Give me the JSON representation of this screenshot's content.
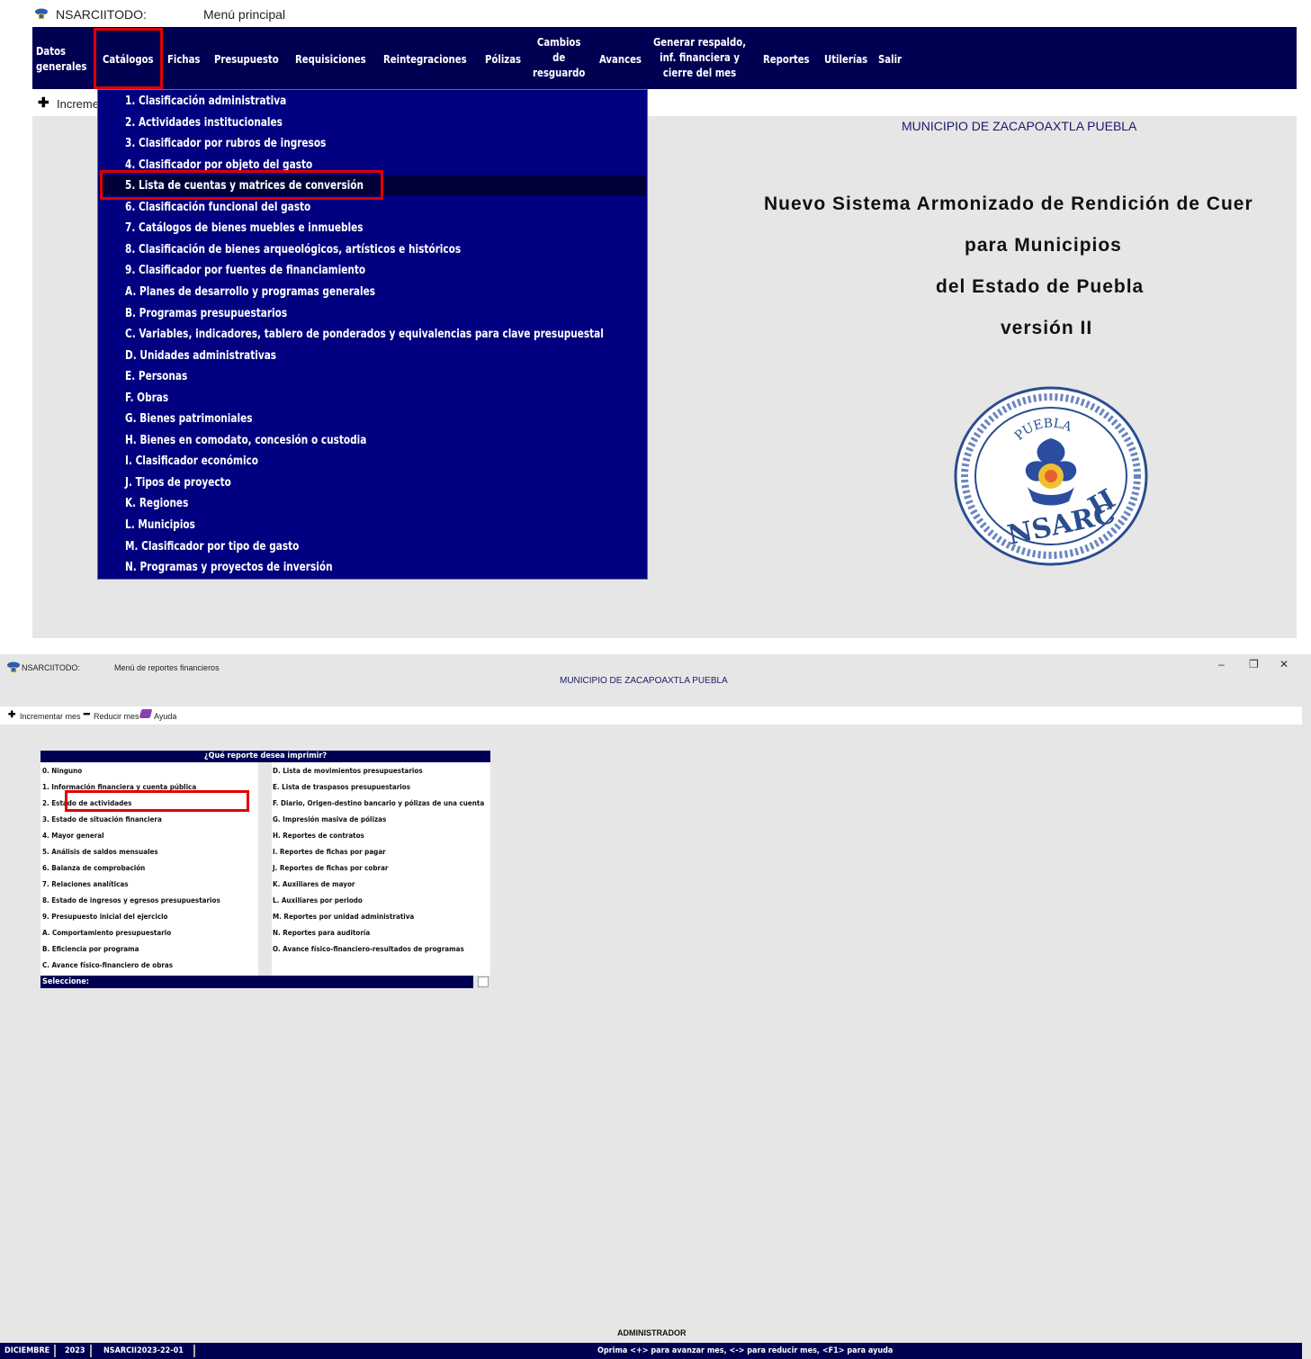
{
  "top": {
    "window": {
      "app_name": "NSARCIITODO:",
      "title": "Menú principal"
    },
    "menubar": [
      "Datos\ngenerales",
      "Catálogos",
      "Fichas",
      "Presupuesto",
      "Requisiciones",
      "Reintegraciones",
      "Pólizas",
      "Cambios\nde\nresguardo",
      "Avances",
      "Generar respaldo,\ninf. financiera y\ncierre del mes",
      "Reportes",
      "Utilerías",
      "Salir"
    ],
    "toolbar_partial": "Increme",
    "catalog_menu": [
      "1. Clasificación administrativa",
      "2. Actividades institucionales",
      "3. Clasificador por rubros de ingresos",
      "4. Clasificador por objeto del gasto",
      "5. Lista de cuentas y matrices de conversión",
      "6. Clasificación funcional del gasto",
      "7. Catálogos de bienes muebles e inmuebles",
      "8. Clasificación de bienes arqueológicos, artísticos e históricos",
      "9. Clasificador por fuentes de financiamiento",
      "A. Planes de desarrollo y programas generales",
      "B. Programas presupuestarios",
      "C. Variables, indicadores, tablero de ponderados y equivalencias para clave presupuestal",
      "D. Unidades administrativas",
      "E. Personas",
      "F. Obras",
      "G. Bienes patrimoniales",
      "H. Bienes en comodato, concesión o custodia",
      "I. Clasificador económico",
      "J. Tipos de proyecto",
      "K. Regiones",
      "L. Municipios",
      "M. Clasificador por tipo de gasto",
      "N. Programas y proyectos de inversión"
    ],
    "highlighted_index": 4,
    "municipality": "MUNICIPIO DE ZACAPOAXTLA PUEBLA",
    "hero_lines": [
      "Nuevo Sistema Armonizado de Rendición de Cuer",
      "para Municipios",
      "del Estado de Puebla",
      "versión II"
    ],
    "logo": {
      "arc_text": "PUEBLA",
      "brand": "NSARC",
      "roman": "II"
    }
  },
  "bottom": {
    "window": {
      "app_name": "NSARCIITODO:",
      "title": "Menú de reportes financieros",
      "municipality": "MUNICIPIO DE ZACAPOAXTLA PUEBLA",
      "controls": [
        "–",
        "❐",
        "✕"
      ]
    },
    "toolbar": {
      "increment": "Incrementar mes",
      "reduce": "Reducir mes",
      "help": "Ayuda"
    },
    "report_dialog": {
      "title": "¿Qué reporte desea imprimir?",
      "left": [
        "0. Ninguno",
        "1. Información financiera y cuenta pública",
        "2. Estado de actividades",
        "3. Estado de situación financiera",
        "4. Mayor general",
        "5. Análisis de saldos mensuales",
        "6. Balanza de comprobación",
        "7. Relaciones analíticas",
        "8. Estado de ingresos y egresos presupuestarios",
        "9. Presupuesto inicial del ejercicio",
        "A. Comportamiento presupuestario",
        "B. Eficiencia por programa",
        "C. Avance físico-financiero de obras"
      ],
      "right": [
        "D. Lista de movimientos presupuestarios",
        "E. Lista de traspasos presupuestarios",
        "F. Diario, Origen-destino bancario y pólizas de una cuenta",
        "G. Impresión masiva de pólizas",
        "H. Reportes de contratos",
        "I. Reportes de fichas por pagar",
        "J. Reportes de fichas por cobrar",
        "K. Auxiliares de mayor",
        "L. Auxiliares por periodo",
        "M. Reportes por unidad administrativa",
        "N. Reportes para auditoría",
        "O. Avance físico-financiero-resultados de programas"
      ],
      "prompt": "Seleccione:"
    },
    "user": "ADMINISTRADOR",
    "statusbar": {
      "month": "DICIEMBRE",
      "year": "2023",
      "db": "NSARCII2023-22-01",
      "hint": "Oprima <+> para avanzar mes, <-> para reducir mes, <F1> para ayuda"
    }
  },
  "colors": {
    "menu_navy": "#000052",
    "dropdown_blue": "#000080",
    "highlight_red": "#e00000",
    "panel_gray": "#e6e6e6"
  }
}
